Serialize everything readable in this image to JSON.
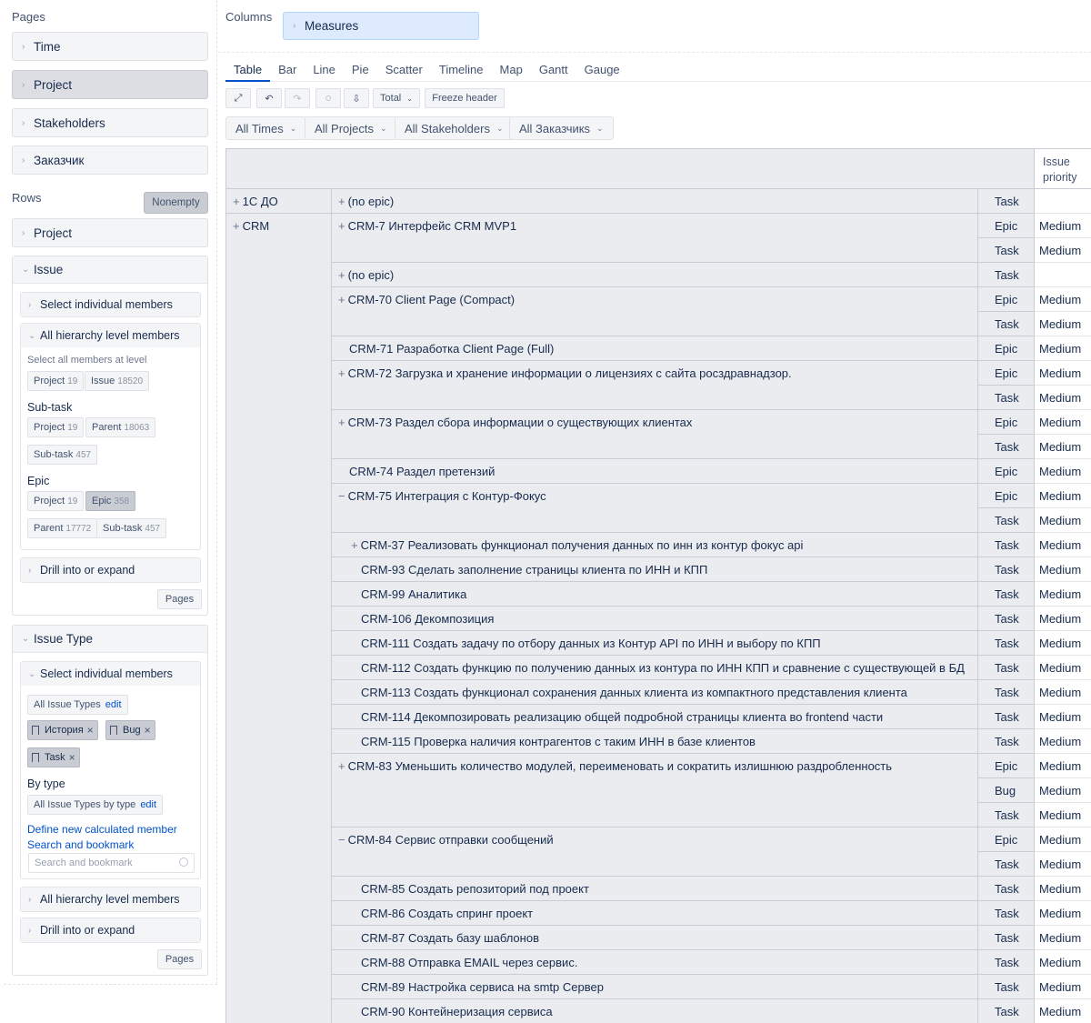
{
  "left": {
    "pages_label": "Pages",
    "pages": [
      "Time",
      "Project",
      "Stakeholders",
      "Заказчик"
    ],
    "rows_label": "Rows",
    "nonempty_label": "Nonempty",
    "row_project": "Project",
    "issue_box": {
      "title": "Issue",
      "select_individual": "Select individual members",
      "all_hierarchy": "All hierarchy level members",
      "select_all_at_level": "Select all members at level",
      "chips1": [
        {
          "label": "Project",
          "count": "19"
        },
        {
          "label": "Issue",
          "count": "18520"
        }
      ],
      "subtask_title": "Sub-task",
      "chips2": [
        {
          "label": "Project",
          "count": "19"
        },
        {
          "label": "Parent",
          "count": "18063"
        },
        {
          "label": "Sub-task",
          "count": "457"
        }
      ],
      "epic_title": "Epic",
      "chips3": [
        {
          "label": "Project",
          "count": "19"
        },
        {
          "label": "Epic",
          "count": "358"
        },
        {
          "label": "Parent",
          "count": "17772"
        },
        {
          "label": "Sub-task",
          "count": "457"
        }
      ],
      "drill": "Drill into or expand",
      "pages_btn": "Pages"
    },
    "issue_type_box": {
      "title": "Issue Type",
      "select_individual": "Select individual members",
      "all_issue_types": "All Issue Types",
      "edit": "edit",
      "tags": [
        "История",
        "Bug",
        "Task"
      ],
      "by_type_title": "By type",
      "all_by_type": "All Issue Types by type",
      "define_link": "Define new calculated member",
      "search_link": "Search and bookmark",
      "search_placeholder": "Search and bookmark",
      "all_hierarchy": "All hierarchy level members",
      "drill": "Drill into or expand",
      "pages_btn": "Pages"
    }
  },
  "columns": {
    "label": "Columns",
    "measures": "Measures"
  },
  "tabs": [
    "Table",
    "Bar",
    "Line",
    "Pie",
    "Scatter",
    "Timeline",
    "Map",
    "Gantt",
    "Gauge"
  ],
  "toolbar": {
    "total": "Total",
    "freeze": "Freeze header"
  },
  "filters": [
    "All Times",
    "All Projects",
    "All Stakeholders",
    "All Заказчикs"
  ],
  "table": {
    "header": "Issue priority",
    "projects": [
      "1С ДО",
      "CRM"
    ],
    "rows": [
      {
        "epic": "(no epic)",
        "type": "Task",
        "priority": ""
      },
      {
        "epic": "CRM-7 Интерфейс CRM MVP1",
        "type": "Epic",
        "priority": "Medium"
      },
      {
        "epic": "",
        "type": "Task",
        "priority": "Medium"
      },
      {
        "epic": "(no epic)",
        "type": "Task",
        "priority": ""
      },
      {
        "epic": "CRM-70 Client Page (Compact)",
        "type": "Epic",
        "priority": "Medium"
      },
      {
        "epic": "",
        "type": "Task",
        "priority": "Medium"
      },
      {
        "epic": "CRM-71 Разработка Client Page (Full)",
        "type": "Epic",
        "priority": "Medium"
      },
      {
        "epic": "CRM-72 Загрузка и хранение информации о лицензиях с сайта росздравнадзор.",
        "type": "Epic",
        "priority": "Medium"
      },
      {
        "epic": "",
        "type": "Task",
        "priority": "Medium"
      },
      {
        "epic": "CRM-73 Раздел сбора информации о существующих клиентах",
        "type": "Epic",
        "priority": "Medium"
      },
      {
        "epic": "",
        "type": "Task",
        "priority": "Medium"
      },
      {
        "epic": "CRM-74 Раздел претензий",
        "type": "Epic",
        "priority": "Medium"
      },
      {
        "epic": "CRM-75 Интеграция с Контур-Фокус",
        "type": "Epic",
        "priority": "Medium"
      },
      {
        "epic": "",
        "type": "Task",
        "priority": "Medium"
      },
      {
        "epic": "CRM-37 Реализовать функционал получения данных по инн из контур фокус api",
        "type": "Task",
        "priority": "Medium"
      },
      {
        "epic": "CRM-93 Сделать заполнение страницы клиента по ИНН и КПП",
        "type": "Task",
        "priority": "Medium"
      },
      {
        "epic": "CRM-99 Аналитика",
        "type": "Task",
        "priority": "Medium"
      },
      {
        "epic": "CRM-106 Декомпозиция",
        "type": "Task",
        "priority": "Medium"
      },
      {
        "epic": "CRM-111 Создать задачу по отбору данных из Контур API по ИНН и выбору по КПП",
        "type": "Task",
        "priority": "Medium"
      },
      {
        "epic": "CRM-112 Создать функцию по получению данных из контура по ИНН КПП и сравнение с существующей в БД",
        "type": "Task",
        "priority": "Medium"
      },
      {
        "epic": "CRM-113 Создать функционал сохранения данных клиента из компактного представления клиента",
        "type": "Task",
        "priority": "Medium"
      },
      {
        "epic": "CRM-114 Декомпозировать реализацию общей подробной страницы клиента во frontend части",
        "type": "Task",
        "priority": "Medium"
      },
      {
        "epic": "CRM-115 Проверка наличия контрагентов с таким ИНН в базе клиентов",
        "type": "Task",
        "priority": "Medium"
      },
      {
        "epic": "CRM-83 Уменьшить количество модулей, переименовать и сократить излишнюю раздробленность",
        "type": "Epic",
        "priority": "Medium"
      },
      {
        "epic": "",
        "type": "Bug",
        "priority": "Medium"
      },
      {
        "epic": "",
        "type": "Task",
        "priority": "Medium"
      },
      {
        "epic": "CRM-84 Сервис отправки сообщений",
        "type": "Epic",
        "priority": "Medium"
      },
      {
        "epic": "",
        "type": "Task",
        "priority": "Medium"
      },
      {
        "epic": "CRM-85 Создать репозиторий под проект",
        "type": "Task",
        "priority": "Medium"
      },
      {
        "epic": "CRM-86 Создать спринг проект",
        "type": "Task",
        "priority": "Medium"
      },
      {
        "epic": "CRM-87 Создать базу шаблонов",
        "type": "Task",
        "priority": "Medium"
      },
      {
        "epic": "CRM-88 Отправка EMAIL через сервис.",
        "type": "Task",
        "priority": "Medium"
      },
      {
        "epic": "CRM-89 Настройка сервиса на smtp Сервер",
        "type": "Task",
        "priority": "Medium"
      },
      {
        "epic": "CRM-90 Контейнеризация сервиса",
        "type": "Task",
        "priority": "Medium"
      }
    ]
  }
}
